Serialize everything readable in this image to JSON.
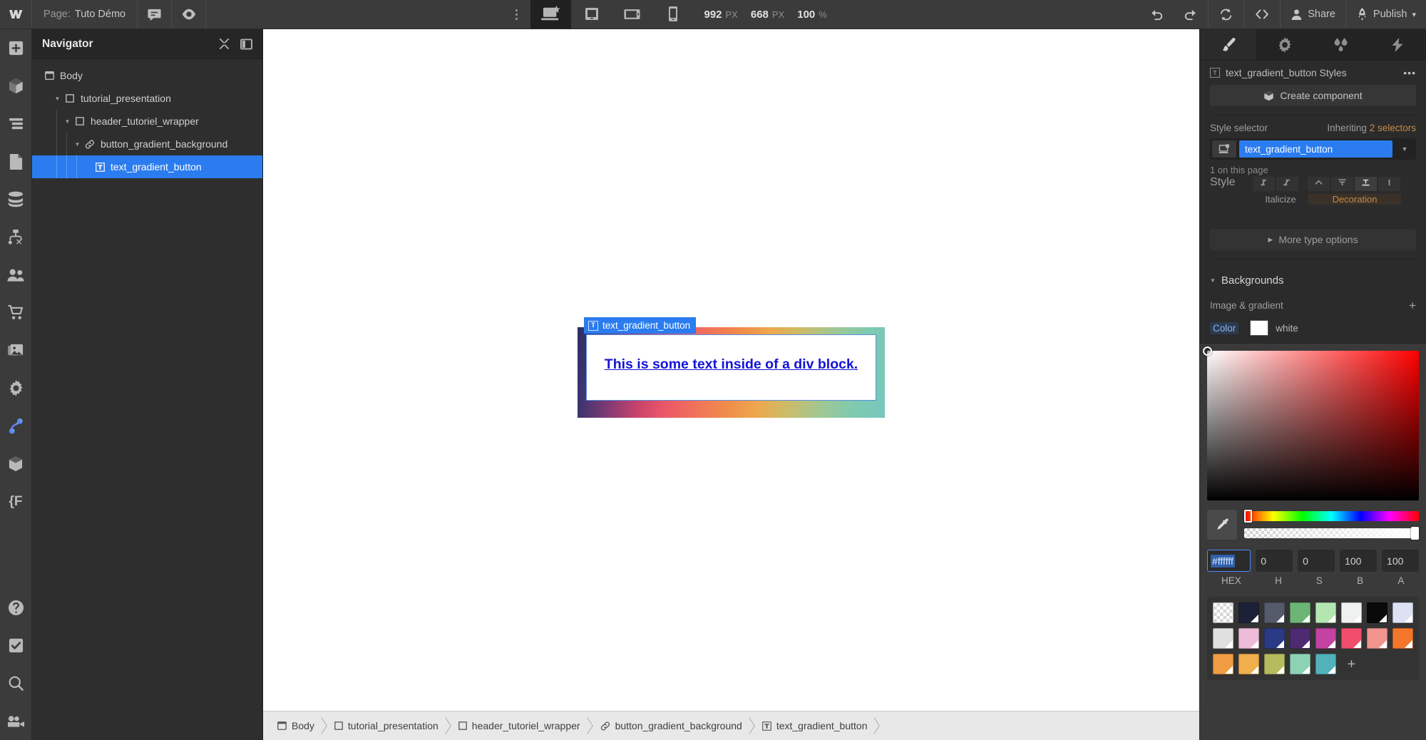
{
  "topbar": {
    "logo": "W",
    "page_label": "Page:",
    "page_name": "Tuto Démo",
    "comment_icon": "comment-icon",
    "preview_icon": "eye-icon",
    "breakpoints": [
      {
        "name": "desktop",
        "label": "Desktop",
        "active": true
      },
      {
        "name": "tablet",
        "label": "Tablet",
        "active": false
      },
      {
        "name": "tablet-landscape",
        "label": "Tablet landscape",
        "active": false
      },
      {
        "name": "mobile",
        "label": "Mobile",
        "active": false
      }
    ],
    "width_value": "992",
    "width_unit": "PX",
    "height_value": "668",
    "height_unit": "PX",
    "zoom_value": "100",
    "zoom_unit": "%",
    "undo_label": "Undo",
    "redo_label": "Redo",
    "sync_label": "Sync",
    "code_label": "Code",
    "share_label": "Share",
    "publish_label": "Publish"
  },
  "rail": {
    "items": [
      {
        "icon": "add-panel-icon",
        "label": "Add elements"
      },
      {
        "icon": "components-icon",
        "label": "Components"
      },
      {
        "icon": "navigator-icon",
        "label": "Navigator"
      },
      {
        "icon": "pages-icon",
        "label": "Pages"
      },
      {
        "icon": "cms-icon",
        "label": "CMS"
      },
      {
        "icon": "logic-icon",
        "label": "Logic"
      },
      {
        "icon": "users-icon",
        "label": "Users"
      },
      {
        "icon": "ecommerce-icon",
        "label": "Ecommerce"
      },
      {
        "icon": "assets-icon",
        "label": "Assets"
      },
      {
        "icon": "settings-gear-icon",
        "label": "Settings"
      },
      {
        "icon": "interactions-icon",
        "label": "Interactions"
      },
      {
        "icon": "cube-icon",
        "label": "3D"
      },
      {
        "icon": "variables-icon",
        "label": "Variables"
      }
    ],
    "bottom_items": [
      {
        "icon": "help-icon",
        "label": "Help"
      },
      {
        "icon": "checkmark-icon",
        "label": "Audits"
      },
      {
        "icon": "search-icon",
        "label": "Search"
      },
      {
        "icon": "video-icon",
        "label": "Video"
      }
    ]
  },
  "navigator": {
    "title": "Navigator",
    "collapse_icon": "collapse-icon",
    "dock_icon": "panel-dock-icon",
    "tree": [
      {
        "label": "Body",
        "icon": "body-icon",
        "depth": 0,
        "arrow": false,
        "selected": false
      },
      {
        "label": "tutorial_presentation",
        "icon": "div-icon",
        "depth": 1,
        "arrow": true,
        "selected": false
      },
      {
        "label": "header_tutoriel_wrapper",
        "icon": "div-icon",
        "depth": 2,
        "arrow": true,
        "selected": false
      },
      {
        "label": "button_gradient_background",
        "icon": "link-icon",
        "depth": 3,
        "arrow": true,
        "selected": false
      },
      {
        "label": "text_gradient_button",
        "icon": "text-icon",
        "depth": 4,
        "arrow": false,
        "selected": true
      }
    ]
  },
  "canvas": {
    "element_tag": "text_gradient_button",
    "tag_icon": "T",
    "text": "This is some text inside of a div block."
  },
  "breadcrumb": [
    {
      "label": "Body",
      "icon": "body-icon"
    },
    {
      "label": "tutorial_presentation",
      "icon": "div-icon"
    },
    {
      "label": "header_tutoriel_wrapper",
      "icon": "div-icon"
    },
    {
      "label": "button_gradient_background",
      "icon": "link-icon"
    },
    {
      "label": "text_gradient_button",
      "icon": "text-icon"
    }
  ],
  "right_panel": {
    "tabs": [
      {
        "name": "style",
        "icon": "paintbrush-icon",
        "active": true
      },
      {
        "name": "settings",
        "icon": "gear-icon",
        "active": false
      },
      {
        "name": "style-manager",
        "icon": "droplets-icon",
        "active": false
      },
      {
        "name": "interactions",
        "icon": "lightning-icon",
        "active": false
      }
    ],
    "styles_title": "text_gradient_button Styles",
    "more_menu": "•••",
    "create_component": "Create component",
    "style_selector_label": "Style selector",
    "inheriting_prefix": "Inheriting",
    "inheriting_count": "2 selectors",
    "selector_name": "text_gradient_button",
    "on_this_page": "1 on this page",
    "typography": {
      "style_label": "Style",
      "italicize": "Italicize",
      "decoration": "Decoration",
      "more_type_options": "More type options"
    },
    "backgrounds": {
      "title": "Backgrounds",
      "image_gradient_label": "Image & gradient",
      "add_icon": "plus-icon",
      "color_label": "Color",
      "color_name": "white"
    }
  },
  "color_picker": {
    "eyedropper_icon": "eyedropper-icon",
    "hex_value": "#ffffff",
    "h_value": "0",
    "s_value": "0",
    "b_value": "100",
    "a_value": "100",
    "hex_label": "HEX",
    "h_label": "H",
    "s_label": "S",
    "b_label": "B",
    "a_label": "A",
    "swatches": [
      "transparent",
      "#1d2138",
      "#555b6b",
      "#6cb575",
      "#b3e6b0",
      "#eef1ef",
      "#0a0a0a",
      "#dde2f2",
      "#e0e0e0",
      "#eebcd8",
      "#2b3a85",
      "#4e2a72",
      "#c342a3",
      "#ef4d6b",
      "#f2958f",
      "#f2762c",
      "#ef9c43",
      "#f0ae4d",
      "#b5bb5e",
      "#8ed2b4",
      "#51b2bb"
    ],
    "add_swatch_icon": "plus-icon"
  }
}
